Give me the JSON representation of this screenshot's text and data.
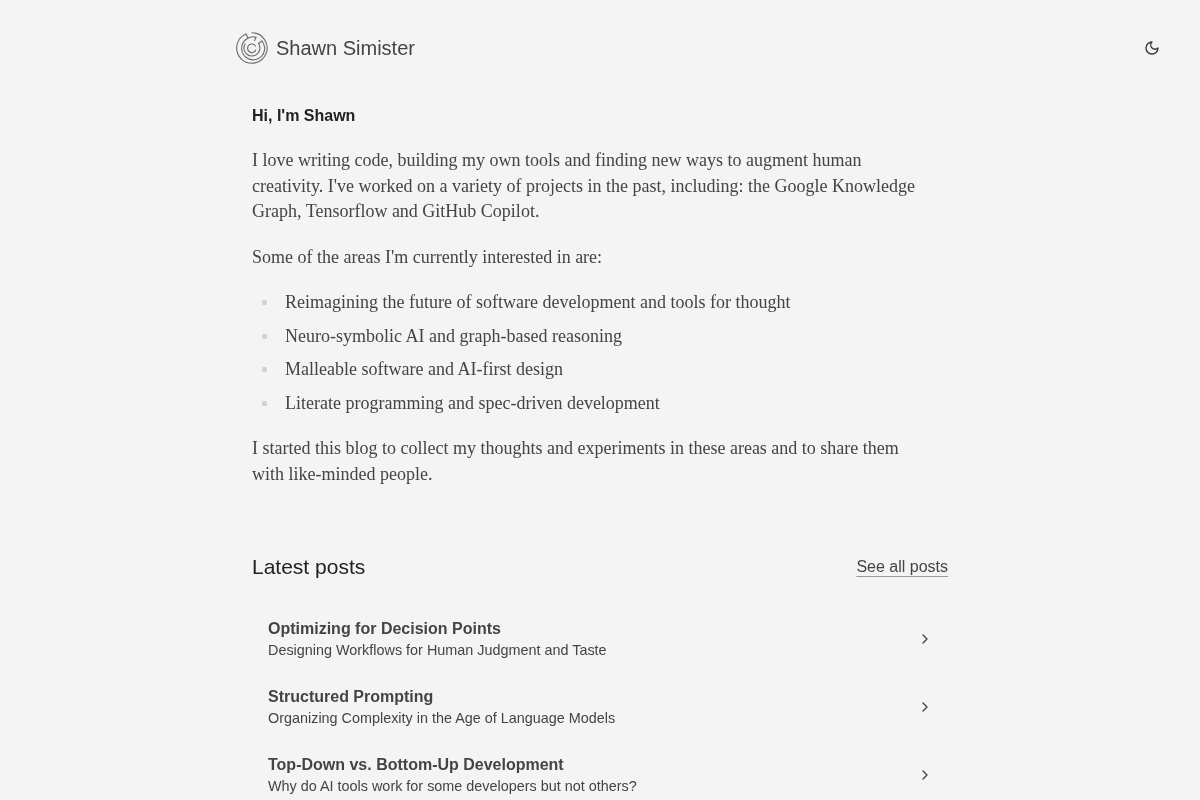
{
  "header": {
    "site_name": "Shawn Simister"
  },
  "intro": {
    "heading": "Hi, I'm Shawn",
    "paragraphs_before": [
      "I love writing code, building my own tools and finding new ways to augment human creativity. I've worked on a variety of projects in the past, including: the Google Knowledge Graph, Tensorflow and GitHub Copilot.",
      "Some of the areas I'm currently interested in are:"
    ],
    "interests": [
      "Reimagining the future of software development and tools for thought",
      "Neuro-symbolic AI and graph-based reasoning",
      "Malleable software and AI-first design",
      "Literate programming and spec-driven development"
    ],
    "paragraphs_after": [
      "I started this blog to collect my thoughts and experiments in these areas and to share them with like-minded people."
    ]
  },
  "latest_posts": {
    "heading": "Latest posts",
    "see_all_link": "See all posts",
    "posts": [
      {
        "title": "Optimizing for Decision Points",
        "subtitle": "Designing Workflows for Human Judgment and Taste"
      },
      {
        "title": "Structured Prompting",
        "subtitle": "Organizing Complexity in the Age of Language Models"
      },
      {
        "title": "Top-Down vs. Bottom-Up Development",
        "subtitle": "Why do AI tools work for some developers but not others?"
      }
    ]
  }
}
